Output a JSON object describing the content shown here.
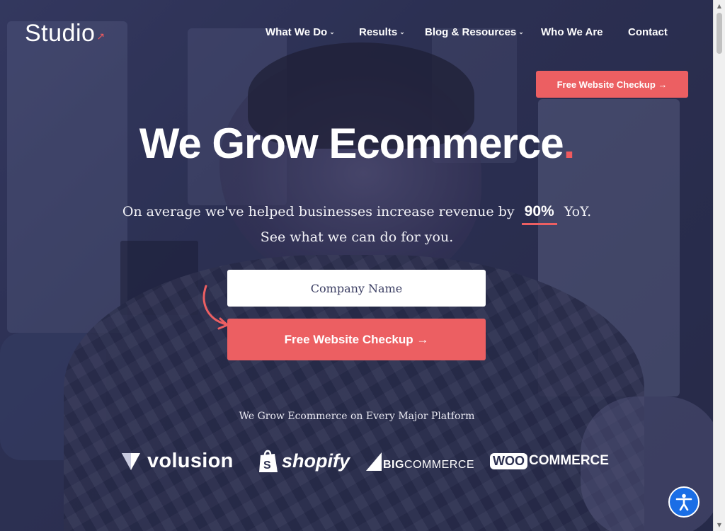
{
  "header": {
    "logo_text": "Studio",
    "logo_arrow": "↗",
    "nav": [
      {
        "label": "What We Do",
        "has_dropdown": true
      },
      {
        "label": "Results",
        "has_dropdown": true
      },
      {
        "label": "Blog & Resources",
        "has_dropdown": true
      },
      {
        "label": "Who We Are",
        "has_dropdown": false
      },
      {
        "label": "Contact",
        "has_dropdown": false
      }
    ],
    "cta_label": "Free Website Checkup →"
  },
  "hero": {
    "title": "We Grow Ecommerce",
    "title_dot": ".",
    "subtitle_pre": "On average we've helped businesses increase revenue by",
    "stat": "90%",
    "subtitle_post": "YoY.",
    "subtitle_line2": "See what we can do for you.",
    "input_placeholder": "Company Name",
    "cta_label": "Free Website Checkup →"
  },
  "platforms": {
    "heading": "We Grow Ecommerce on Every Major Platform",
    "items": [
      {
        "name": "volusion",
        "icon": "volusion-logo-icon"
      },
      {
        "name": "shopify",
        "icon": "shopify-bag-icon"
      },
      {
        "name_bold": "BIG",
        "name_rest": "COMMERCE",
        "icon": "bigcommerce-logo-icon"
      },
      {
        "badge": "WOO",
        "name": "COMMERCE",
        "icon": "woocommerce-logo-icon"
      }
    ]
  },
  "colors": {
    "accent": "#ec5f62",
    "accessibility_button": "#1a6ee6"
  },
  "accessibility": {
    "icon": "accessibility-icon"
  }
}
